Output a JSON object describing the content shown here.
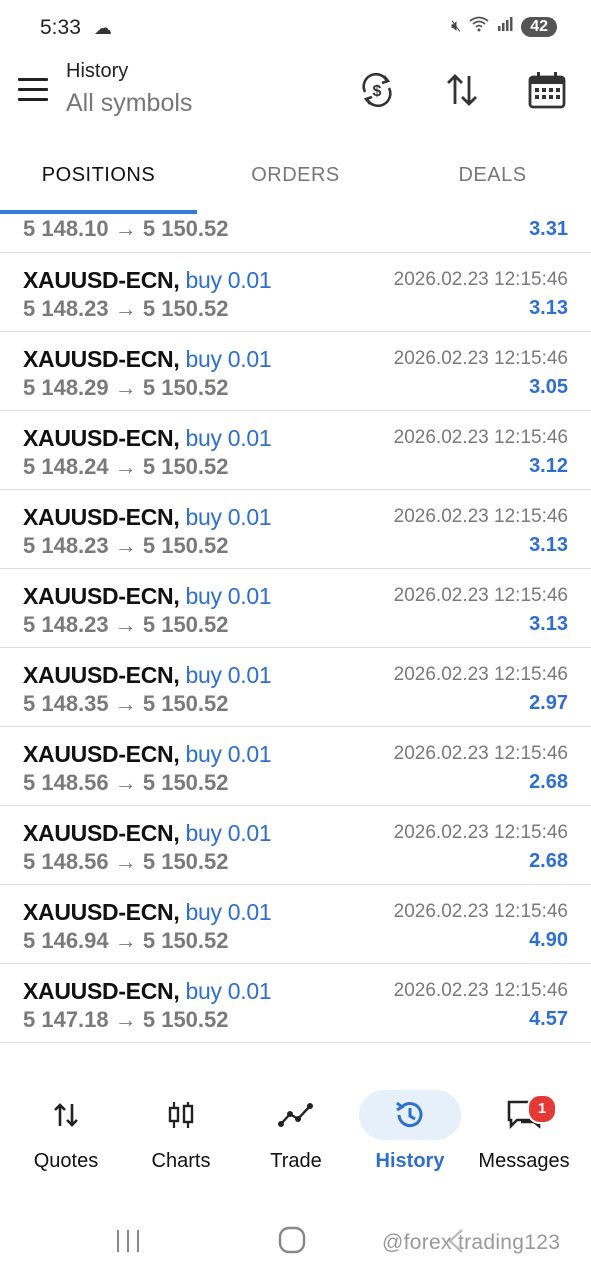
{
  "status_bar": {
    "time": "5:33",
    "battery": "42",
    "icons": [
      "weather-icon",
      "mute-icon",
      "wifi-icon",
      "signal-icon"
    ]
  },
  "app_bar": {
    "title": "History",
    "subtitle": "All symbols",
    "actions": [
      "currency-exchange-icon",
      "sort-icon",
      "calendar-icon"
    ]
  },
  "tabs": [
    {
      "label": "POSITIONS",
      "active": true
    },
    {
      "label": "ORDERS",
      "active": false
    },
    {
      "label": "DEALS",
      "active": false
    }
  ],
  "partial_row": {
    "prices": "5 148.10 → 5 150.52",
    "profit": "3.31"
  },
  "positions": [
    {
      "symbol": "XAUUSD-ECN,",
      "side": "buy 0.01",
      "date": "2026.02.23 12:15:46",
      "prices": "5 148.23 → 5 150.52",
      "profit": "3.13"
    },
    {
      "symbol": "XAUUSD-ECN,",
      "side": "buy 0.01",
      "date": "2026.02.23 12:15:46",
      "prices": "5 148.29 → 5 150.52",
      "profit": "3.05"
    },
    {
      "symbol": "XAUUSD-ECN,",
      "side": "buy 0.01",
      "date": "2026.02.23 12:15:46",
      "prices": "5 148.24 → 5 150.52",
      "profit": "3.12"
    },
    {
      "symbol": "XAUUSD-ECN,",
      "side": "buy 0.01",
      "date": "2026.02.23 12:15:46",
      "prices": "5 148.23 → 5 150.52",
      "profit": "3.13"
    },
    {
      "symbol": "XAUUSD-ECN,",
      "side": "buy 0.01",
      "date": "2026.02.23 12:15:46",
      "prices": "5 148.23 → 5 150.52",
      "profit": "3.13"
    },
    {
      "symbol": "XAUUSD-ECN,",
      "side": "buy 0.01",
      "date": "2026.02.23 12:15:46",
      "prices": "5 148.35 → 5 150.52",
      "profit": "2.97"
    },
    {
      "symbol": "XAUUSD-ECN,",
      "side": "buy 0.01",
      "date": "2026.02.23 12:15:46",
      "prices": "5 148.56 → 5 150.52",
      "profit": "2.68"
    },
    {
      "symbol": "XAUUSD-ECN,",
      "side": "buy 0.01",
      "date": "2026.02.23 12:15:46",
      "prices": "5 148.56 → 5 150.52",
      "profit": "2.68"
    },
    {
      "symbol": "XAUUSD-ECN,",
      "side": "buy 0.01",
      "date": "2026.02.23 12:15:46",
      "prices": "5 146.94 → 5 150.52",
      "profit": "4.90"
    },
    {
      "symbol": "XAUUSD-ECN,",
      "side": "buy 0.01",
      "date": "2026.02.23 12:15:46",
      "prices": "5 147.18 → 5 150.52",
      "profit": "4.57"
    }
  ],
  "bottom_nav": [
    {
      "label": "Quotes",
      "icon": "quotes-icon",
      "active": false
    },
    {
      "label": "Charts",
      "icon": "candlestick-chart-icon",
      "active": false
    },
    {
      "label": "Trade",
      "icon": "trade-icon",
      "active": false
    },
    {
      "label": "History",
      "icon": "history-icon",
      "active": true
    },
    {
      "label": "Messages",
      "icon": "messages-icon",
      "active": false,
      "badge": "1"
    }
  ],
  "watermark": "@forex trading123",
  "colors": {
    "accent": "#2e6fd0",
    "tab_indicator": "#2f7fd6",
    "muted_text": "#7a7a7a",
    "badge": "#e53935",
    "active_nav_bg": "#e6f0fb"
  }
}
